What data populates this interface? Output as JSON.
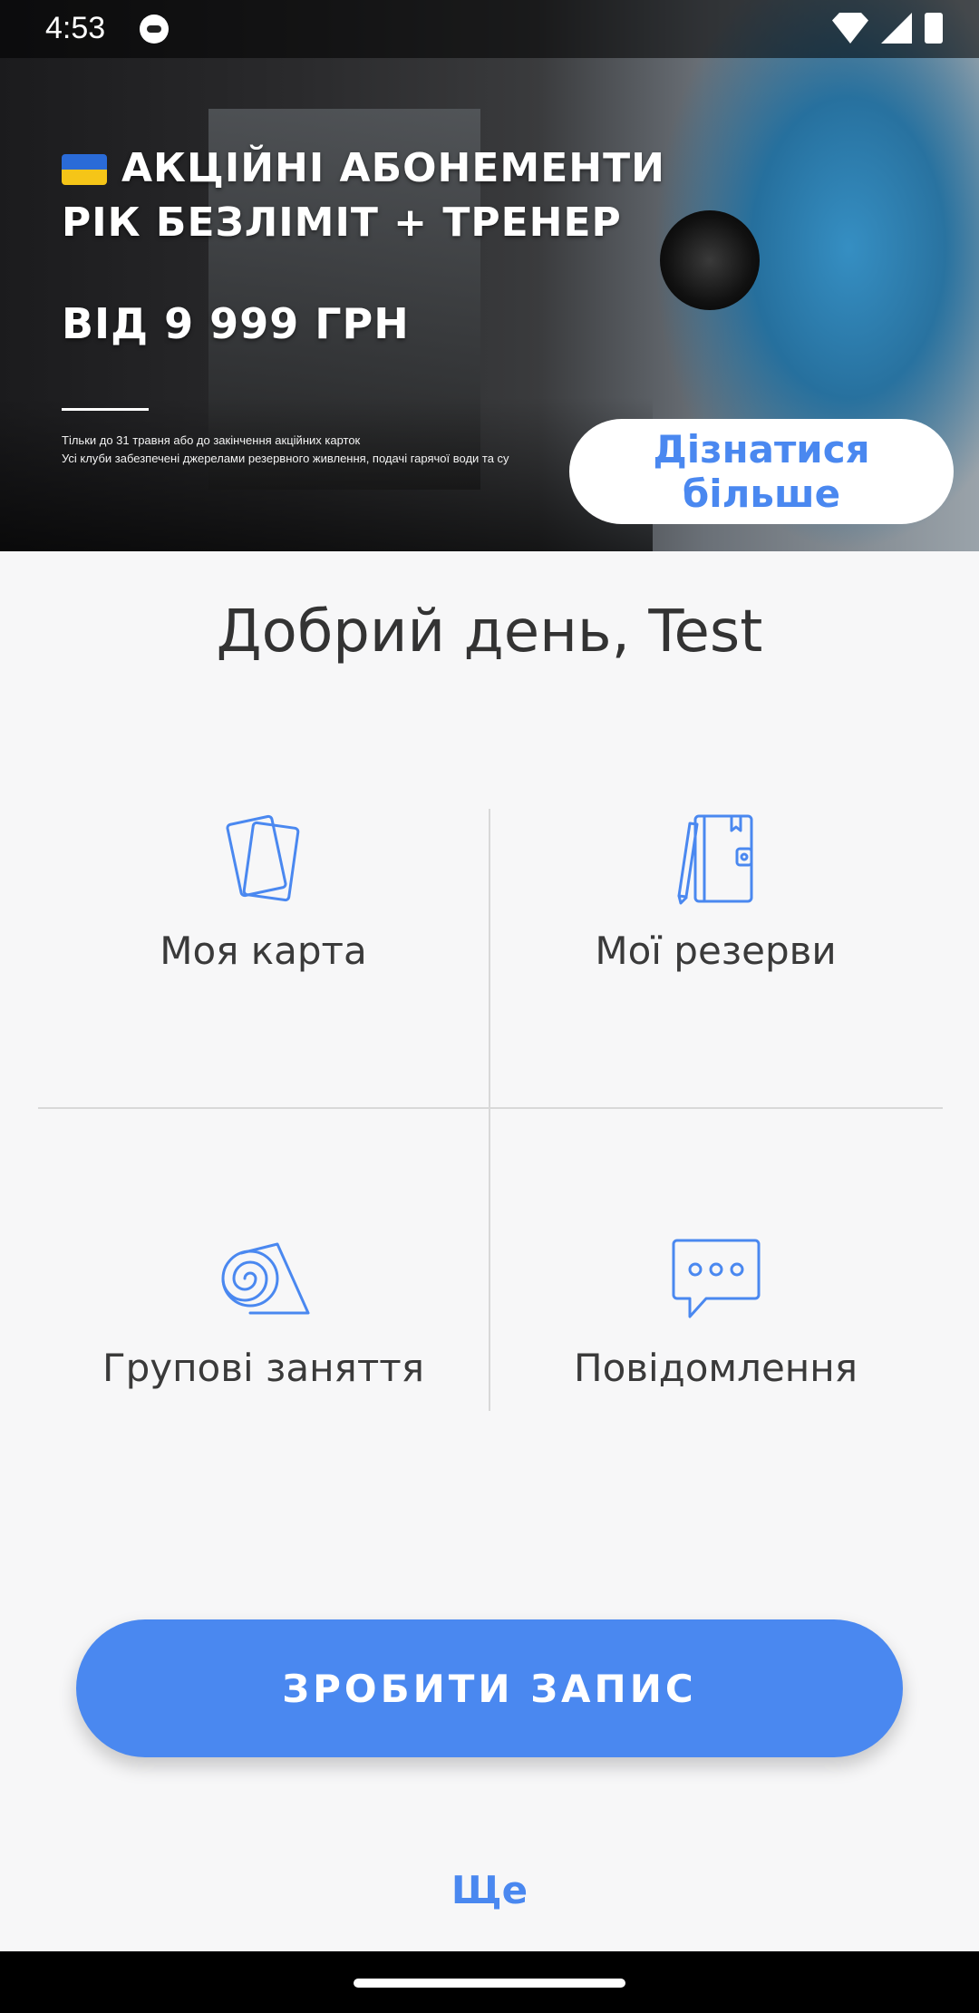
{
  "status_bar": {
    "time": "4:53"
  },
  "banner": {
    "line1": "АКЦІЙНІ АБОНЕМЕНТИ",
    "line2": "РІК БЕЗЛІМІТ + ТРЕНЕР",
    "price": "ВІД 9 999 ГРН",
    "note1": "Тільки до 31 травня або до закінчення акційних карток",
    "note2": "Усі клуби забезпечені джерелами резервного живлення, подачі гарячої води та су",
    "cta": "Дізнатися більше"
  },
  "greeting": "Добрий день, Test",
  "tiles": [
    {
      "label": "Моя карта",
      "icon": "cards-icon"
    },
    {
      "label": "Мої резерви",
      "icon": "notebook-icon"
    },
    {
      "label": "Групові заняття",
      "icon": "yoga-mat-icon"
    },
    {
      "label": "Повідомлення",
      "icon": "chat-icon"
    }
  ],
  "primary_action": "ЗРОБИТИ ЗАПИС",
  "more_link": "Ще",
  "colors": {
    "accent": "#4a88f0",
    "background": "#f7f7f8",
    "divider": "#d8d8d8"
  }
}
